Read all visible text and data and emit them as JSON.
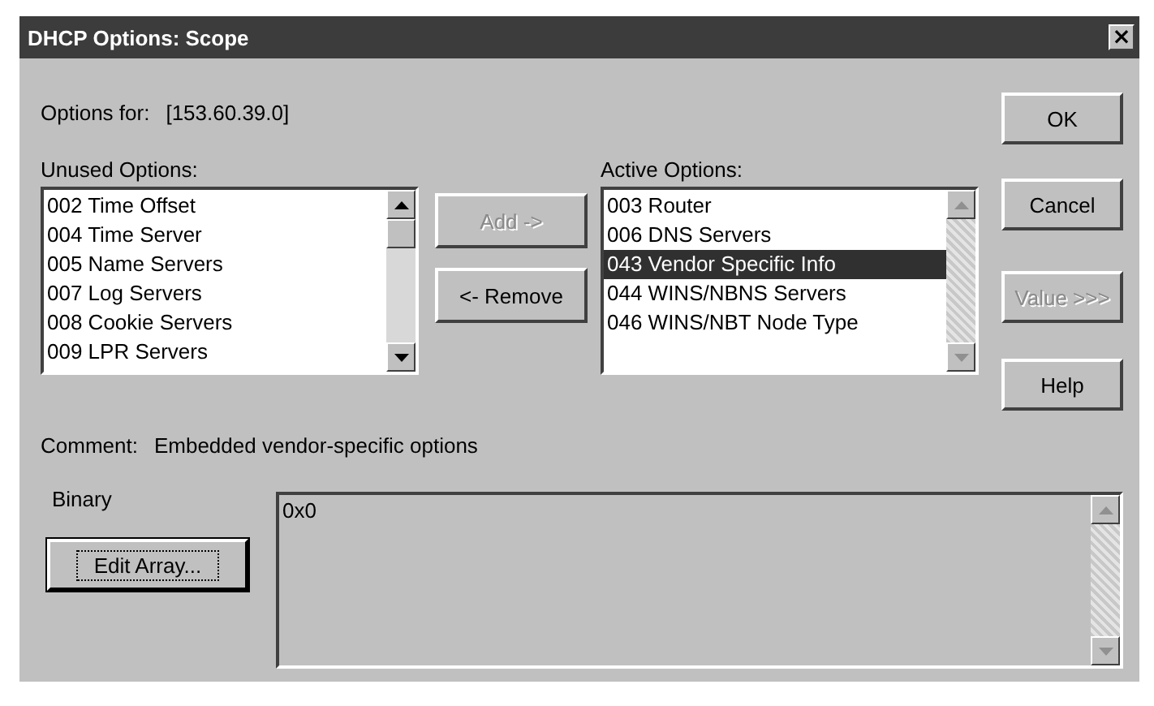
{
  "window": {
    "title": "DHCP Options: Scope",
    "close": "×"
  },
  "options_for": {
    "label": "Options for:",
    "value": "[153.60.39.0]"
  },
  "unused_options": {
    "label": "Unused Options:",
    "items": [
      {
        "label": "002 Time Offset",
        "selected": false
      },
      {
        "label": "004 Time Server",
        "selected": false
      },
      {
        "label": "005 Name Servers",
        "selected": false
      },
      {
        "label": "007 Log Servers",
        "selected": false
      },
      {
        "label": "008 Cookie Servers",
        "selected": false
      },
      {
        "label": "009 LPR Servers",
        "selected": false
      }
    ]
  },
  "move_buttons": [
    {
      "label": "Add ->",
      "disabled": true
    },
    {
      "label": "<- Remove",
      "disabled": false
    }
  ],
  "active_options": {
    "label": "Active Options:",
    "items": [
      {
        "label": "003 Router",
        "selected": false
      },
      {
        "label": "006 DNS Servers",
        "selected": false
      },
      {
        "label": "043 Vendor Specific Info",
        "selected": true
      },
      {
        "label": "044 WINS/NBNS Servers",
        "selected": false
      },
      {
        "label": "046 WINS/NBT Node Type",
        "selected": false
      }
    ]
  },
  "dialog_buttons": [
    {
      "label": "OK",
      "disabled": false
    },
    {
      "label": "Cancel",
      "disabled": false
    },
    {
      "label": "Value >>>",
      "disabled": true
    },
    {
      "label": "Help",
      "disabled": false
    }
  ],
  "comment": {
    "label": "Comment:",
    "value": "Embedded vendor-specific options"
  },
  "value_editor": {
    "type_label": "Binary",
    "button": "Edit Array...",
    "value": "0x0"
  }
}
